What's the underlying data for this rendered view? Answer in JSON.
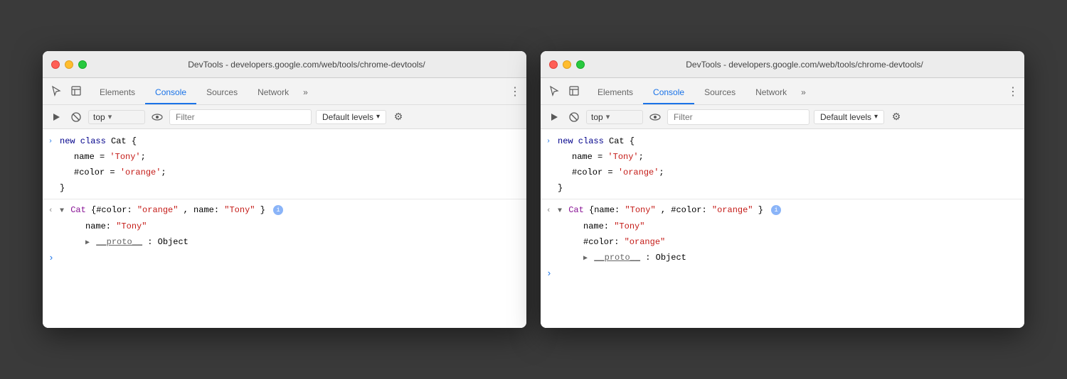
{
  "windows": [
    {
      "id": "window-left",
      "title": "DevTools - developers.google.com/web/tools/chrome-devtools/",
      "tabs": [
        {
          "id": "elements",
          "label": "Elements",
          "active": false
        },
        {
          "id": "console",
          "label": "Console",
          "active": true
        },
        {
          "id": "sources",
          "label": "Sources",
          "active": false
        },
        {
          "id": "network",
          "label": "Network",
          "active": false
        },
        {
          "id": "more",
          "label": "»",
          "active": false
        }
      ],
      "toolbar": {
        "top_value": "top",
        "filter_placeholder": "Filter",
        "default_levels": "Default levels"
      },
      "console_output": [
        {
          "type": "code",
          "icon": ">",
          "lines": [
            {
              "text": "new class Cat {",
              "indent": 0,
              "style": "normal"
            },
            {
              "text": "name = 'Tony';",
              "indent": 1,
              "style": "normal"
            },
            {
              "text": "#color = 'orange';",
              "indent": 1,
              "style": "normal"
            },
            {
              "text": "}",
              "indent": 0,
              "style": "normal"
            }
          ]
        },
        {
          "type": "result",
          "icon": "<",
          "expanded": true,
          "summary": "▼ Cat {#color: \"orange\", name: \"Tony\"}",
          "properties": [
            {
              "key": "name",
              "value": "\"Tony\"",
              "indent": 2
            }
          ],
          "proto": {
            "text": "▶ __proto__: Object",
            "indent": 2
          }
        }
      ],
      "show_color_expanded": false
    },
    {
      "id": "window-right",
      "title": "DevTools - developers.google.com/web/tools/chrome-devtools/",
      "tabs": [
        {
          "id": "elements",
          "label": "Elements",
          "active": false
        },
        {
          "id": "console",
          "label": "Console",
          "active": true
        },
        {
          "id": "sources",
          "label": "Sources",
          "active": false
        },
        {
          "id": "network",
          "label": "Network",
          "active": false
        },
        {
          "id": "more",
          "label": "»",
          "active": false
        }
      ],
      "toolbar": {
        "top_value": "top",
        "filter_placeholder": "Filter",
        "default_levels": "Default levels"
      },
      "show_color_expanded": true
    }
  ],
  "colors": {
    "accent_blue": "#1a73e8",
    "string_red": "#c41a16",
    "keyword_blue": "#00008b",
    "prop_purple": "#871094"
  },
  "icons": {
    "cursor": "⊹",
    "inspect": "◻",
    "clear": "⊘",
    "eye": "◉",
    "chevron_down": "▾",
    "gear": "⚙",
    "more_vert": "⋮"
  }
}
